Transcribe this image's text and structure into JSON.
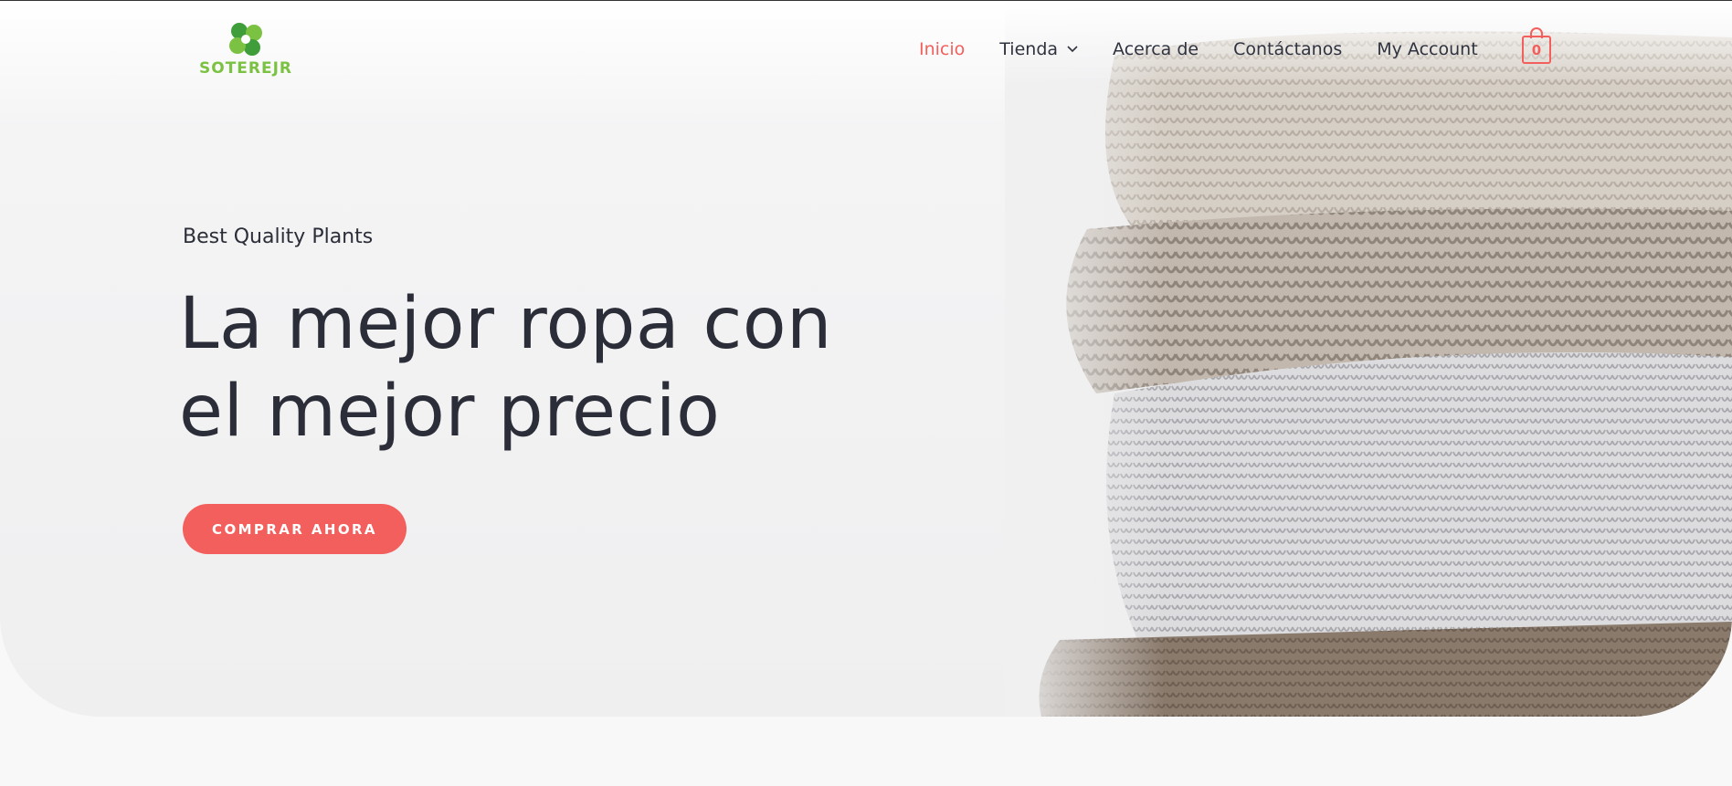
{
  "brand": {
    "logo_text": "SOTEREJR",
    "logo_color": "#7cc242"
  },
  "nav": {
    "items": [
      {
        "label": "Inicio",
        "active": true
      },
      {
        "label": "Tienda",
        "has_dropdown": true
      },
      {
        "label": "Acerca de"
      },
      {
        "label": "Contáctanos"
      },
      {
        "label": "My Account"
      }
    ],
    "cart_count": "0",
    "accent_color": "#f25f5c"
  },
  "hero": {
    "tagline": "Best Quality Plants",
    "headline_line1": "La mejor ropa con",
    "headline_line2": "el mejor precio",
    "cta_label": "COMPRAR AHORA",
    "image_subject": "stack of folded knitted sweaters"
  },
  "colors": {
    "accent": "#f25f5c",
    "text": "#2b2e38",
    "logo_green": "#7cc242"
  }
}
